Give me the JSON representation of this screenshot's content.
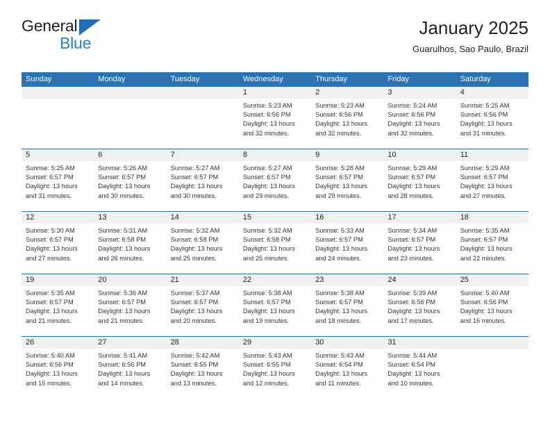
{
  "brand": {
    "name_part1": "General",
    "name_part2": "Blue",
    "logo_icon": "triangle-logo-icon"
  },
  "header": {
    "title": "January 2025",
    "location": "Guarulhos, Sao Paulo, Brazil"
  },
  "colors": {
    "header_blue": "#2b72b4",
    "brand_blue": "#2181c9",
    "logo_blue": "#1f6fb5",
    "day_band_gray": "#f0f0f0",
    "text_dark": "#231f20",
    "text_body": "#333333"
  },
  "weekdays": [
    "Sunday",
    "Monday",
    "Tuesday",
    "Wednesday",
    "Thursday",
    "Friday",
    "Saturday"
  ],
  "weeks": [
    [
      {
        "empty": true
      },
      {
        "empty": true
      },
      {
        "empty": true
      },
      {
        "date": "1",
        "sunrise": "Sunrise: 5:23 AM",
        "sunset": "Sunset: 6:56 PM",
        "daylight1": "Daylight: 13 hours",
        "daylight2": "and 32 minutes."
      },
      {
        "date": "2",
        "sunrise": "Sunrise: 5:23 AM",
        "sunset": "Sunset: 6:56 PM",
        "daylight1": "Daylight: 13 hours",
        "daylight2": "and 32 minutes."
      },
      {
        "date": "3",
        "sunrise": "Sunrise: 5:24 AM",
        "sunset": "Sunset: 6:56 PM",
        "daylight1": "Daylight: 13 hours",
        "daylight2": "and 32 minutes."
      },
      {
        "date": "4",
        "sunrise": "Sunrise: 5:25 AM",
        "sunset": "Sunset: 6:56 PM",
        "daylight1": "Daylight: 13 hours",
        "daylight2": "and 31 minutes."
      }
    ],
    [
      {
        "date": "5",
        "sunrise": "Sunrise: 5:25 AM",
        "sunset": "Sunset: 6:57 PM",
        "daylight1": "Daylight: 13 hours",
        "daylight2": "and 31 minutes."
      },
      {
        "date": "6",
        "sunrise": "Sunrise: 5:26 AM",
        "sunset": "Sunset: 6:57 PM",
        "daylight1": "Daylight: 13 hours",
        "daylight2": "and 30 minutes."
      },
      {
        "date": "7",
        "sunrise": "Sunrise: 5:27 AM",
        "sunset": "Sunset: 6:57 PM",
        "daylight1": "Daylight: 13 hours",
        "daylight2": "and 30 minutes."
      },
      {
        "date": "8",
        "sunrise": "Sunrise: 5:27 AM",
        "sunset": "Sunset: 6:57 PM",
        "daylight1": "Daylight: 13 hours",
        "daylight2": "and 29 minutes."
      },
      {
        "date": "9",
        "sunrise": "Sunrise: 5:28 AM",
        "sunset": "Sunset: 6:57 PM",
        "daylight1": "Daylight: 13 hours",
        "daylight2": "and 29 minutes."
      },
      {
        "date": "10",
        "sunrise": "Sunrise: 5:29 AM",
        "sunset": "Sunset: 6:57 PM",
        "daylight1": "Daylight: 13 hours",
        "daylight2": "and 28 minutes."
      },
      {
        "date": "11",
        "sunrise": "Sunrise: 5:29 AM",
        "sunset": "Sunset: 6:57 PM",
        "daylight1": "Daylight: 13 hours",
        "daylight2": "and 27 minutes."
      }
    ],
    [
      {
        "date": "12",
        "sunrise": "Sunrise: 5:30 AM",
        "sunset": "Sunset: 6:57 PM",
        "daylight1": "Daylight: 13 hours",
        "daylight2": "and 27 minutes."
      },
      {
        "date": "13",
        "sunrise": "Sunrise: 5:31 AM",
        "sunset": "Sunset: 6:58 PM",
        "daylight1": "Daylight: 13 hours",
        "daylight2": "and 26 minutes."
      },
      {
        "date": "14",
        "sunrise": "Sunrise: 5:32 AM",
        "sunset": "Sunset: 6:58 PM",
        "daylight1": "Daylight: 13 hours",
        "daylight2": "and 25 minutes."
      },
      {
        "date": "15",
        "sunrise": "Sunrise: 5:32 AM",
        "sunset": "Sunset: 6:58 PM",
        "daylight1": "Daylight: 13 hours",
        "daylight2": "and 25 minutes."
      },
      {
        "date": "16",
        "sunrise": "Sunrise: 5:33 AM",
        "sunset": "Sunset: 6:57 PM",
        "daylight1": "Daylight: 13 hours",
        "daylight2": "and 24 minutes."
      },
      {
        "date": "17",
        "sunrise": "Sunrise: 5:34 AM",
        "sunset": "Sunset: 6:57 PM",
        "daylight1": "Daylight: 13 hours",
        "daylight2": "and 23 minutes."
      },
      {
        "date": "18",
        "sunrise": "Sunrise: 5:35 AM",
        "sunset": "Sunset: 6:57 PM",
        "daylight1": "Daylight: 13 hours",
        "daylight2": "and 22 minutes."
      }
    ],
    [
      {
        "date": "19",
        "sunrise": "Sunrise: 5:35 AM",
        "sunset": "Sunset: 6:57 PM",
        "daylight1": "Daylight: 13 hours",
        "daylight2": "and 21 minutes."
      },
      {
        "date": "20",
        "sunrise": "Sunrise: 5:36 AM",
        "sunset": "Sunset: 6:57 PM",
        "daylight1": "Daylight: 13 hours",
        "daylight2": "and 21 minutes."
      },
      {
        "date": "21",
        "sunrise": "Sunrise: 5:37 AM",
        "sunset": "Sunset: 6:57 PM",
        "daylight1": "Daylight: 13 hours",
        "daylight2": "and 20 minutes."
      },
      {
        "date": "22",
        "sunrise": "Sunrise: 5:38 AM",
        "sunset": "Sunset: 6:57 PM",
        "daylight1": "Daylight: 13 hours",
        "daylight2": "and 19 minutes."
      },
      {
        "date": "23",
        "sunrise": "Sunrise: 5:38 AM",
        "sunset": "Sunset: 6:57 PM",
        "daylight1": "Daylight: 13 hours",
        "daylight2": "and 18 minutes."
      },
      {
        "date": "24",
        "sunrise": "Sunrise: 5:39 AM",
        "sunset": "Sunset: 6:56 PM",
        "daylight1": "Daylight: 13 hours",
        "daylight2": "and 17 minutes."
      },
      {
        "date": "25",
        "sunrise": "Sunrise: 5:40 AM",
        "sunset": "Sunset: 6:56 PM",
        "daylight1": "Daylight: 13 hours",
        "daylight2": "and 16 minutes."
      }
    ],
    [
      {
        "date": "26",
        "sunrise": "Sunrise: 5:40 AM",
        "sunset": "Sunset: 6:56 PM",
        "daylight1": "Daylight: 13 hours",
        "daylight2": "and 15 minutes."
      },
      {
        "date": "27",
        "sunrise": "Sunrise: 5:41 AM",
        "sunset": "Sunset: 6:56 PM",
        "daylight1": "Daylight: 13 hours",
        "daylight2": "and 14 minutes."
      },
      {
        "date": "28",
        "sunrise": "Sunrise: 5:42 AM",
        "sunset": "Sunset: 6:55 PM",
        "daylight1": "Daylight: 13 hours",
        "daylight2": "and 13 minutes."
      },
      {
        "date": "29",
        "sunrise": "Sunrise: 5:43 AM",
        "sunset": "Sunset: 6:55 PM",
        "daylight1": "Daylight: 13 hours",
        "daylight2": "and 12 minutes."
      },
      {
        "date": "30",
        "sunrise": "Sunrise: 5:43 AM",
        "sunset": "Sunset: 6:54 PM",
        "daylight1": "Daylight: 13 hours",
        "daylight2": "and 11 minutes."
      },
      {
        "date": "31",
        "sunrise": "Sunrise: 5:44 AM",
        "sunset": "Sunset: 6:54 PM",
        "daylight1": "Daylight: 13 hours",
        "daylight2": "and 10 minutes."
      },
      {
        "empty": true
      }
    ]
  ]
}
